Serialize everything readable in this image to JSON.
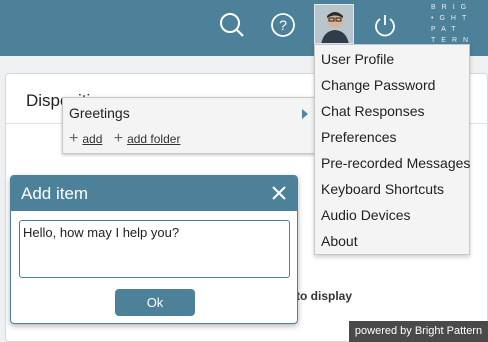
{
  "topbar": {
    "brand_lines": [
      "BRIG",
      "•GHT",
      "PAT",
      "TERN"
    ]
  },
  "page": {
    "title": "Dispositions",
    "empty_text": "to display"
  },
  "folder_popup": {
    "folder_name": "Greetings",
    "add_label": "add",
    "add_folder_label": "add folder"
  },
  "user_menu": {
    "items": [
      "User Profile",
      "Change Password",
      "Chat Responses",
      "Preferences",
      "Pre-recorded Messages",
      "Keyboard Shortcuts",
      "Audio Devices",
      "About"
    ]
  },
  "dialog": {
    "title": "Add item",
    "input_value": "Hello, how may I help you?",
    "ok_label": "Ok"
  },
  "footer": {
    "powered_by": "powered by Bright Pattern"
  },
  "colors": {
    "accent": "#4c8199",
    "menu_bg": "#f4f4f4",
    "footer_bg": "#4a4a4a"
  }
}
